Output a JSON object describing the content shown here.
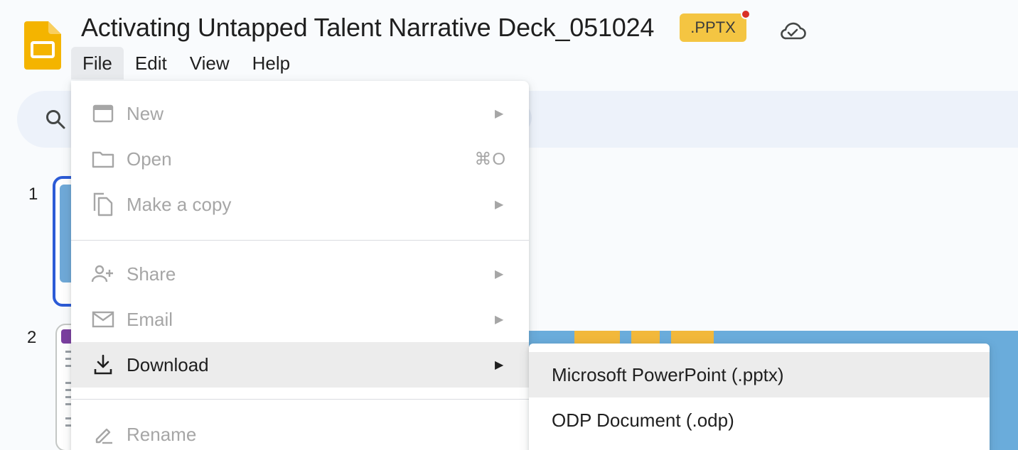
{
  "header": {
    "title": "Activating Untapped Talent Narrative Deck_051024",
    "badge": ".PPTX",
    "app_icon": "slides-logo-icon",
    "cloud_icon": "cloud-check-icon"
  },
  "menubar": {
    "items": [
      "File",
      "Edit",
      "View",
      "Help"
    ]
  },
  "filmstrip": {
    "slides": [
      {
        "number": "1"
      },
      {
        "number": "2"
      }
    ]
  },
  "file_menu": {
    "items": [
      {
        "label": "New",
        "icon": "presentation-icon",
        "has_submenu": true,
        "enabled": false
      },
      {
        "label": "Open",
        "icon": "folder-icon",
        "shortcut": "⌘O",
        "enabled": false
      },
      {
        "label": "Make a copy",
        "icon": "copy-icon",
        "has_submenu": true,
        "enabled": false
      },
      {
        "label": "Share",
        "icon": "person-add-icon",
        "has_submenu": true,
        "enabled": false
      },
      {
        "label": "Email",
        "icon": "mail-icon",
        "has_submenu": true,
        "enabled": false
      },
      {
        "label": "Download",
        "icon": "download-icon",
        "has_submenu": true,
        "enabled": true
      },
      {
        "label": "Rename",
        "icon": "rename-icon",
        "enabled": false
      }
    ]
  },
  "download_submenu": {
    "items": [
      "Microsoft PowerPoint (.pptx)",
      "ODP Document (.odp)"
    ]
  },
  "colors": {
    "accent": "#2c5bd6",
    "badge": "#f4c542",
    "slides_yellow": "#f4b400"
  }
}
